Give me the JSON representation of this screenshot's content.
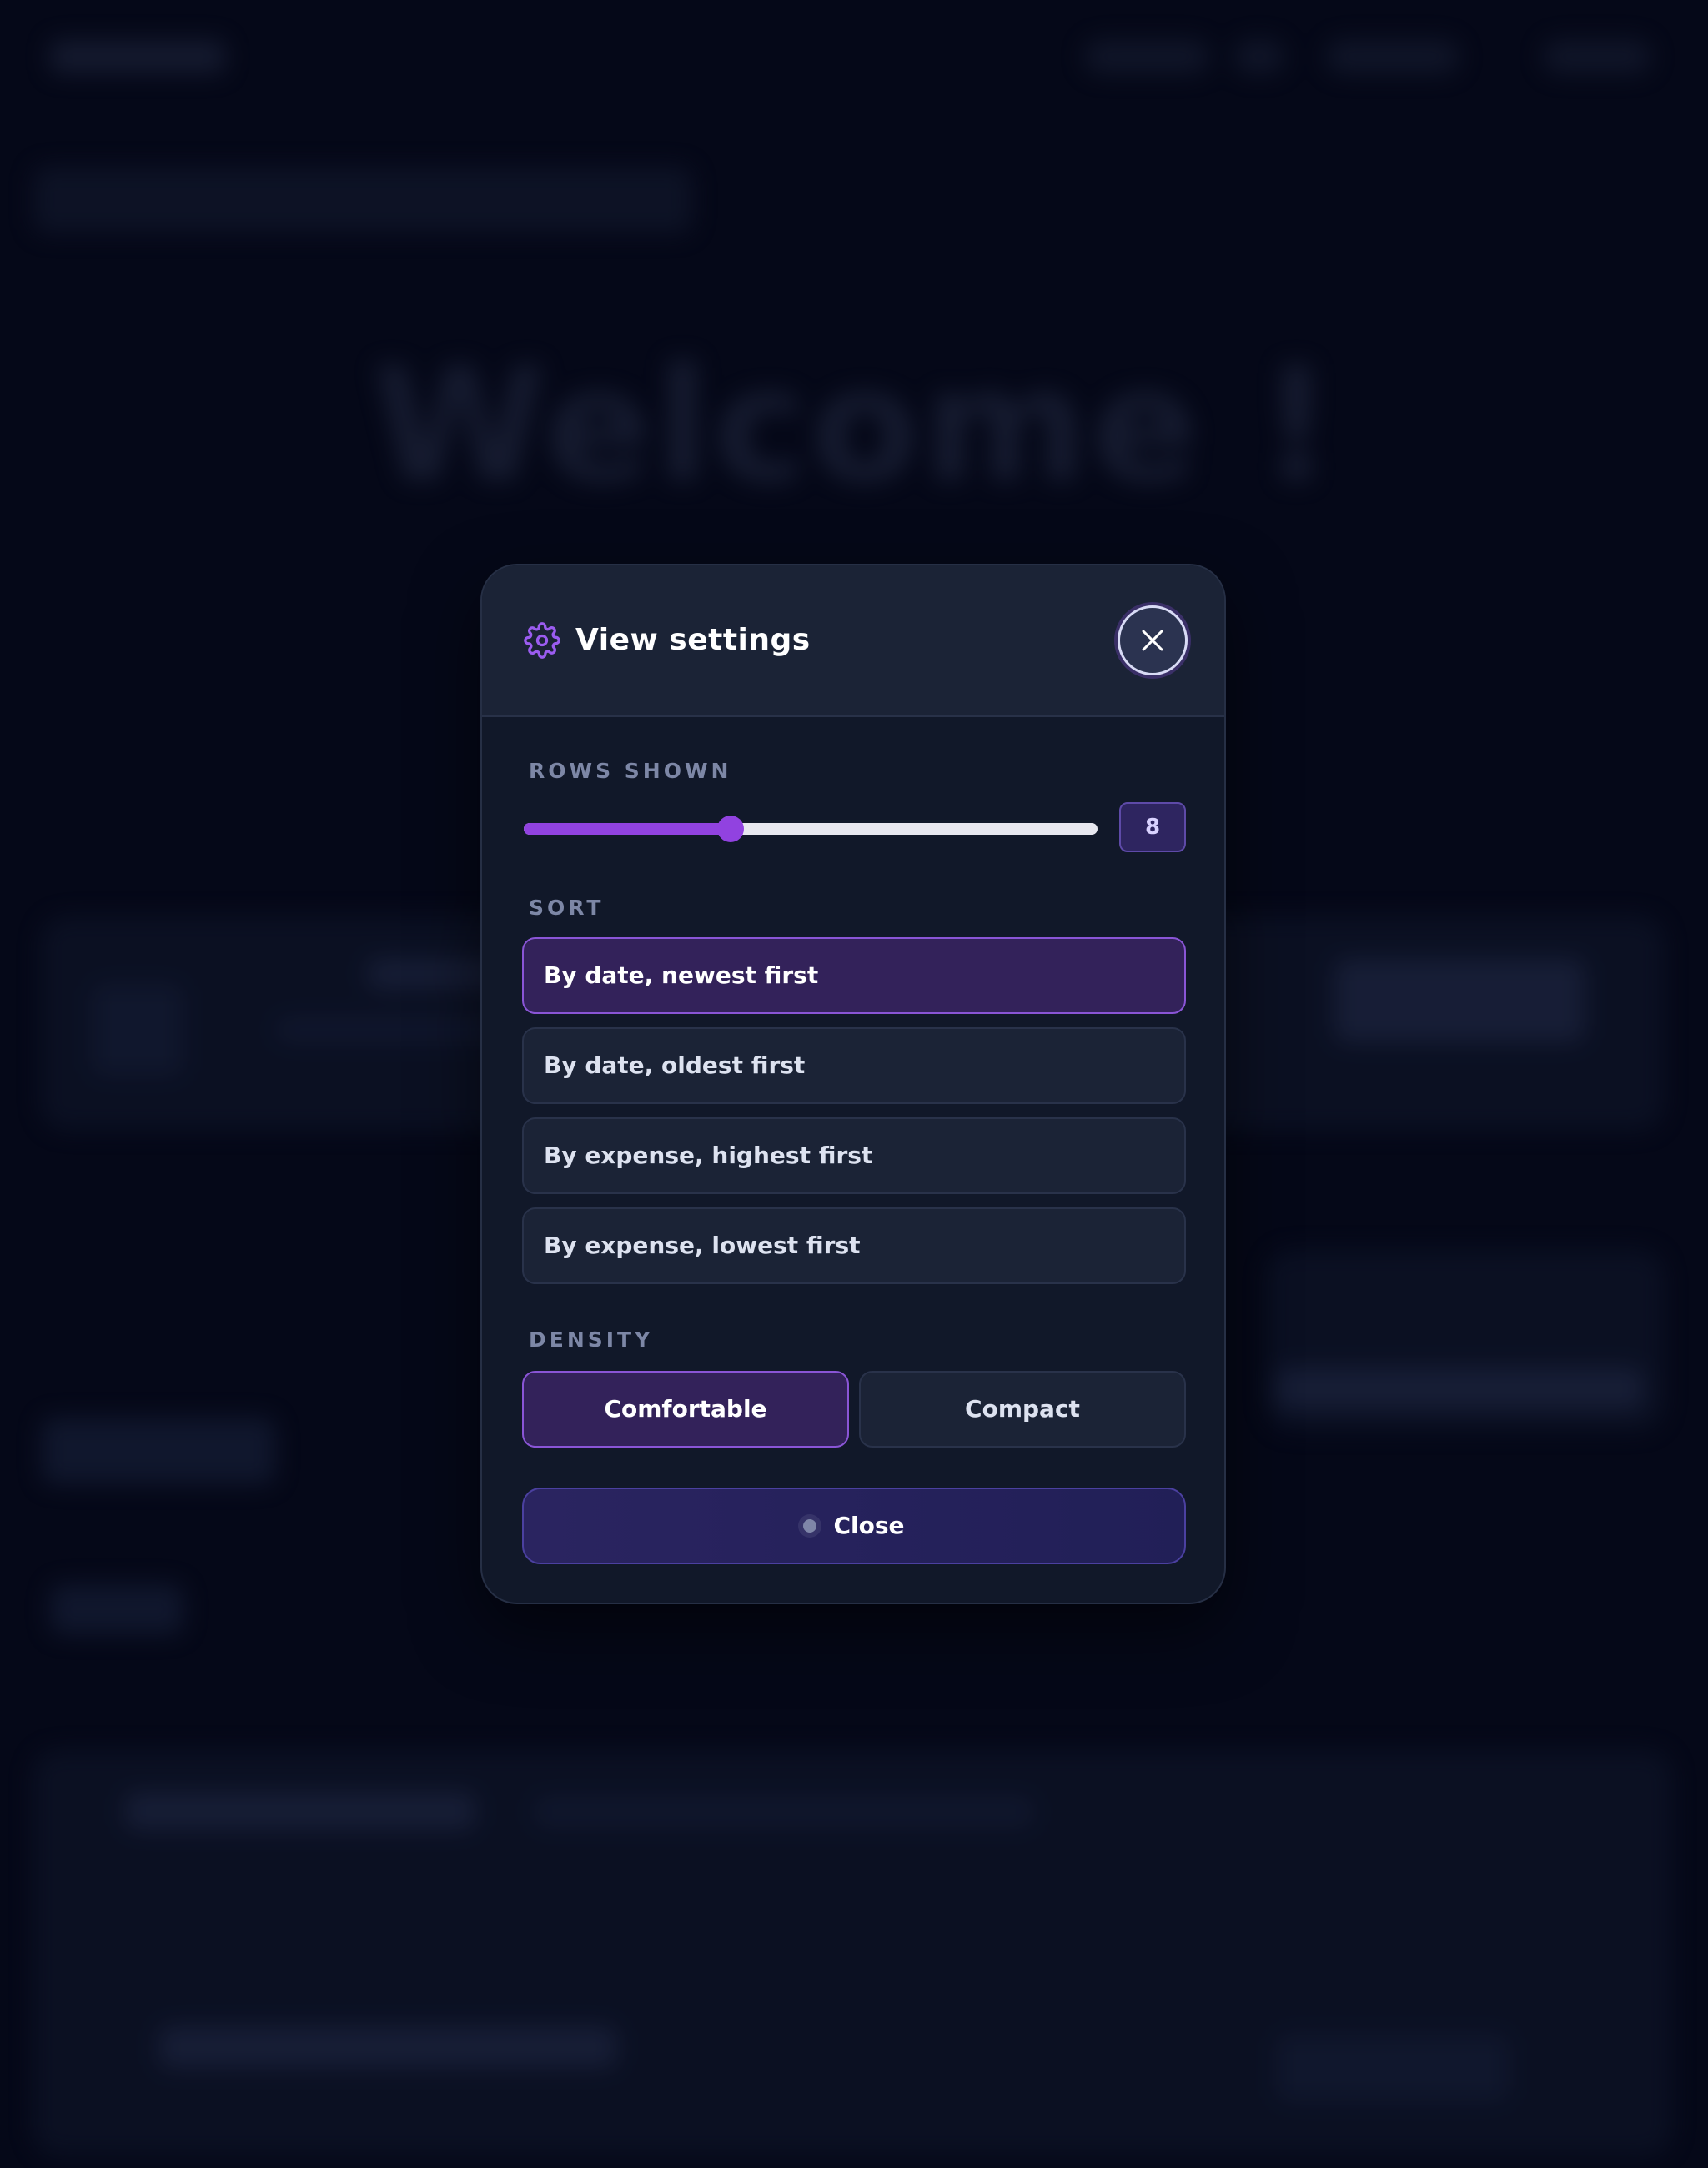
{
  "background": {
    "hero_title": "Welcome !"
  },
  "modal": {
    "title": "View settings",
    "header_icon": "gear-icon",
    "close_icon": "close-icon",
    "rows_shown": {
      "label": "ROWS SHOWN",
      "value": 8,
      "value_text": "8",
      "fraction": 0.36
    },
    "sort": {
      "label": "SORT",
      "options": [
        {
          "label": "By date, newest first",
          "selected": true
        },
        {
          "label": "By date, oldest first",
          "selected": false
        },
        {
          "label": "By expense, highest first",
          "selected": false
        },
        {
          "label": "By expense, lowest first",
          "selected": false
        }
      ]
    },
    "density": {
      "label": "DENSITY",
      "options": [
        {
          "label": "Comfortable",
          "selected": true
        },
        {
          "label": "Compact",
          "selected": false
        }
      ]
    },
    "close_button": {
      "label": "Close"
    }
  },
  "colors": {
    "accent": "#9142e0",
    "selected_bg": "#33225a",
    "modal_bg": "#111829",
    "page_bg": "#050818"
  }
}
